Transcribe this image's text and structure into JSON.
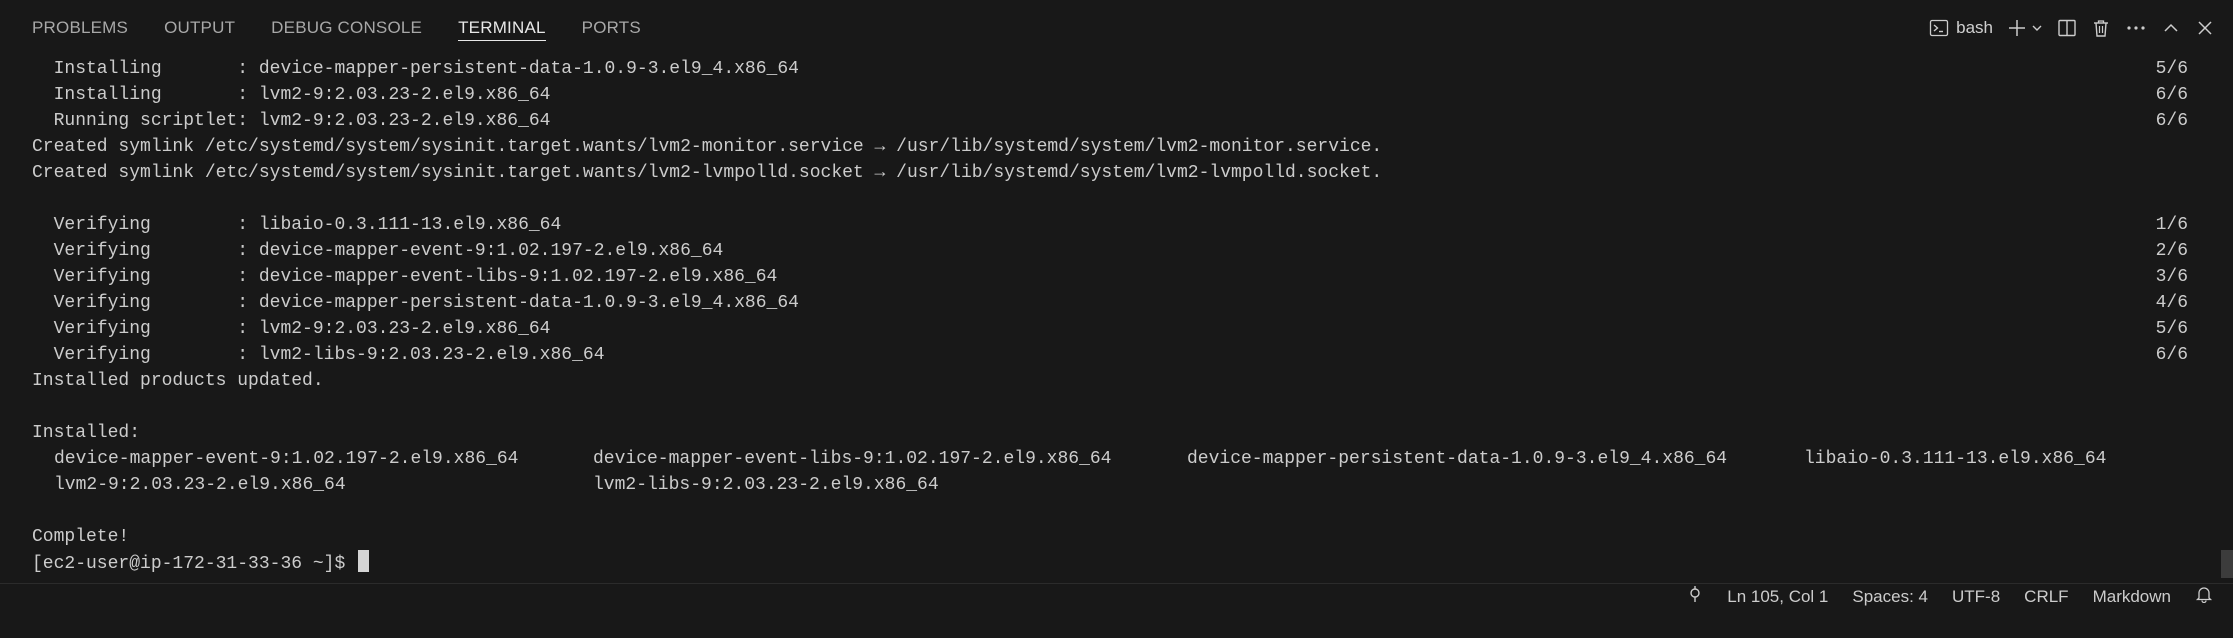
{
  "panel": {
    "tabs": [
      {
        "label": "PROBLEMS"
      },
      {
        "label": "OUTPUT"
      },
      {
        "label": "DEBUG CONSOLE"
      },
      {
        "label": "TERMINAL",
        "active": true
      },
      {
        "label": "PORTS"
      }
    ],
    "actions": {
      "shell_label": "bash",
      "icons": [
        "terminal-icon",
        "plus-icon",
        "chevron-down-icon",
        "split-icon",
        "trash-icon",
        "more-icon",
        "chevron-up-icon",
        "close-icon"
      ]
    }
  },
  "terminal": {
    "lines": [
      {
        "text": "  Installing       : device-mapper-persistent-data-1.0.9-3.el9_4.x86_64",
        "right": "5/6"
      },
      {
        "text": "  Installing       : lvm2-9:2.03.23-2.el9.x86_64",
        "right": "6/6"
      },
      {
        "text": "  Running scriptlet: lvm2-9:2.03.23-2.el9.x86_64",
        "right": "6/6"
      },
      {
        "text": "Created symlink /etc/systemd/system/sysinit.target.wants/lvm2-monitor.service → /usr/lib/systemd/system/lvm2-monitor.service.",
        "right": ""
      },
      {
        "text": "Created symlink /etc/systemd/system/sysinit.target.wants/lvm2-lvmpolld.socket → /usr/lib/systemd/system/lvm2-lvmpolld.socket.",
        "right": ""
      },
      {
        "text": "",
        "right": ""
      },
      {
        "text": "  Verifying        : libaio-0.3.111-13.el9.x86_64",
        "right": "1/6"
      },
      {
        "text": "  Verifying        : device-mapper-event-9:1.02.197-2.el9.x86_64",
        "right": "2/6"
      },
      {
        "text": "  Verifying        : device-mapper-event-libs-9:1.02.197-2.el9.x86_64",
        "right": "3/6"
      },
      {
        "text": "  Verifying        : device-mapper-persistent-data-1.0.9-3.el9_4.x86_64",
        "right": "4/6"
      },
      {
        "text": "  Verifying        : lvm2-9:2.03.23-2.el9.x86_64",
        "right": "5/6"
      },
      {
        "text": "  Verifying        : lvm2-libs-9:2.03.23-2.el9.x86_64",
        "right": "6/6"
      },
      {
        "text": "Installed products updated.",
        "right": ""
      },
      {
        "text": "",
        "right": ""
      },
      {
        "text": "Installed:",
        "right": ""
      }
    ],
    "installed_packages": [
      [
        "device-mapper-event-9:1.02.197-2.el9.x86_64",
        "device-mapper-event-libs-9:1.02.197-2.el9.x86_64",
        "device-mapper-persistent-data-1.0.9-3.el9_4.x86_64",
        "libaio-0.3.111-13.el9.x86_64"
      ],
      [
        "lvm2-9:2.03.23-2.el9.x86_64",
        "lvm2-libs-9:2.03.23-2.el9.x86_64"
      ]
    ],
    "complete_text": "Complete!",
    "prompt": "[ec2-user@ip-172-31-33-36 ~]$ "
  },
  "status_bar": {
    "position": "Ln 105, Col 1",
    "spaces": "Spaces: 4",
    "encoding": "UTF-8",
    "eol": "CRLF",
    "language": "Markdown"
  },
  "colors": {
    "background": "#181818",
    "text": "#cccccc",
    "active_tab": "#e8e8e8"
  }
}
